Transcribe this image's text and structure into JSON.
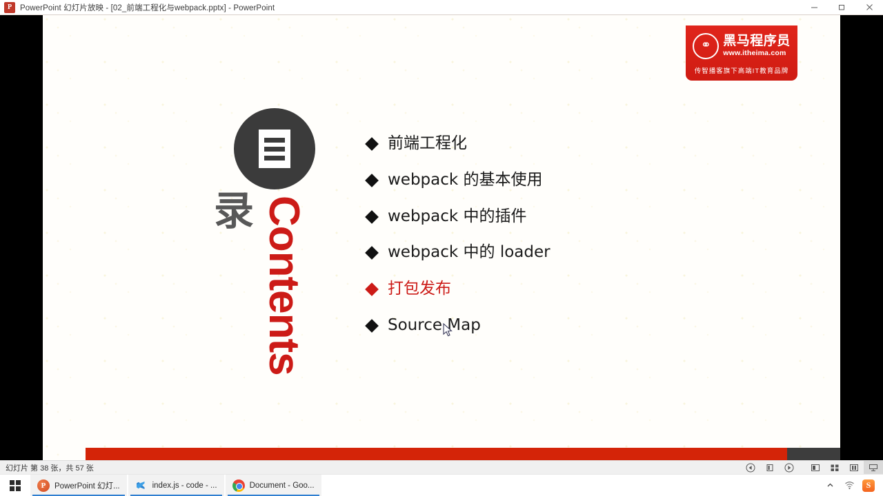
{
  "window": {
    "title": "PowerPoint 幻灯片放映 - [02_前端工程化与webpack.pptx] - PowerPoint",
    "app_icon": "powerpoint-icon",
    "minimize_label": "最小化",
    "restore_label": "向下还原",
    "close_label": "关闭"
  },
  "slide": {
    "logo": {
      "brand_cn": "黑马程序员",
      "url": "www.itheima.com",
      "tagline": "传智播客旗下高端IT教育品牌",
      "mark_glyph": "horse-logo-icon",
      "color": "#d5180f"
    },
    "emblem": {
      "glyph": "list-lines-icon",
      "circle_color": "#3b3b3b"
    },
    "heading_cn": "录",
    "heading_en": "Contents",
    "heading_en_color": "#cc1b17",
    "toc": [
      {
        "label": "前端工程化",
        "active": false
      },
      {
        "label": "webpack 的基本使用",
        "active": false
      },
      {
        "label": "webpack 中的插件",
        "active": false
      },
      {
        "label": "webpack 中的 loader",
        "active": false
      },
      {
        "label": "打包发布",
        "active": true
      },
      {
        "label": "Source Map",
        "active": false
      }
    ],
    "active_color": "#cc1b17",
    "progress_percent": 88,
    "progress_color": "#d42408"
  },
  "statusbar": {
    "slide_text": "幻灯片 第 38 张，共 57 张",
    "buttons": [
      {
        "name": "previous-slide-button",
        "glyph": "◁"
      },
      {
        "name": "pause-button",
        "glyph": "❙❙"
      },
      {
        "name": "next-slide-button",
        "glyph": "▷"
      },
      {
        "name": "normal-view-button",
        "glyph": "▤"
      },
      {
        "name": "slide-sorter-button",
        "glyph": "▦"
      },
      {
        "name": "reading-view-button",
        "glyph": "▥"
      },
      {
        "name": "slideshow-view-button",
        "glyph": "▽"
      }
    ]
  },
  "taskbar": {
    "start_label": "开始",
    "items": [
      {
        "label": "PowerPoint 幻灯...",
        "icon": "powerpoint-icon",
        "active": true
      },
      {
        "label": "index.js - code - ...",
        "icon": "vscode-icon",
        "active": true
      },
      {
        "label": "Document - Goo...",
        "icon": "chrome-icon",
        "active": true
      }
    ],
    "tray": [
      {
        "name": "show-hidden-icons",
        "glyph": "⌃"
      },
      {
        "name": "network-icon",
        "glyph": "✷"
      },
      {
        "name": "sogou-ime-icon",
        "glyph": "S"
      }
    ]
  }
}
